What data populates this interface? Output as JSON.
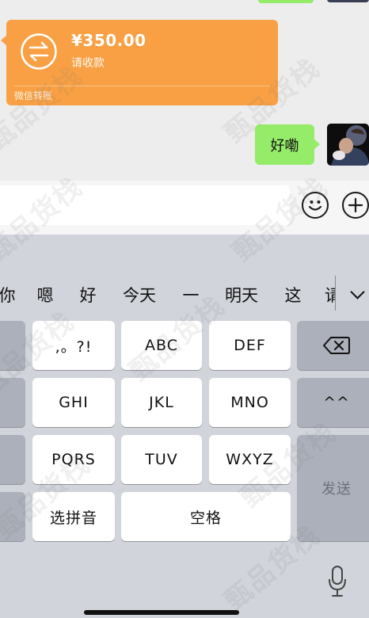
{
  "transfer": {
    "amount": "¥350.00",
    "description": "请收款",
    "footer": "微信转账",
    "color": "#f8a043"
  },
  "message": {
    "text": "好嘞",
    "bubble_color": "#95ec69"
  },
  "input": {
    "value": "",
    "emoji_icon": "smiley-icon",
    "plus_icon": "plus-circle-icon"
  },
  "keyboard": {
    "candidates": [
      "你",
      "嗯",
      "好",
      "今天",
      "一",
      "明天",
      "这",
      "请"
    ],
    "expand_icon": "chevron-down-icon",
    "keys": {
      "punct": ",。?!",
      "abc": "ABC",
      "def": "DEF",
      "ghi": "GHI",
      "jkl": "JKL",
      "mno": "MNO",
      "pqrs": "PQRS",
      "tuv": "TUV",
      "wxyz": "WXYZ",
      "emoticon": "^^",
      "pinyin": "选拼音",
      "space": "空格",
      "send": "发送"
    },
    "delete_icon": "backspace-icon",
    "mic_icon": "microphone-icon",
    "bg_color": "#d1d4db"
  },
  "watermark": "甄品货栈"
}
